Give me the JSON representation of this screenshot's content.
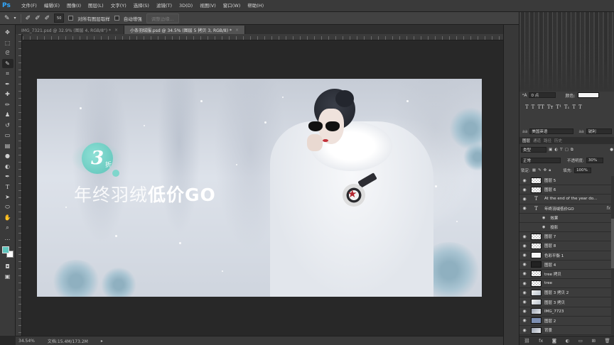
{
  "app": {
    "logo": "Ps"
  },
  "menu": [
    "文件(F)",
    "编辑(E)",
    "图像(I)",
    "图层(L)",
    "文字(Y)",
    "选择(S)",
    "滤镜(T)",
    "3D(D)",
    "视图(V)",
    "窗口(W)",
    "帮助(H)"
  ],
  "options": {
    "brush_size": "50",
    "sample_all_label": "对所有图层取样",
    "auto_enhance_label": "自动增强",
    "refine_edge_label": "调整边缘..."
  },
  "tabs": [
    {
      "label": "IMG_7321.psd @ 32.9% (图层 4, RGB/8\") *",
      "active": false
    },
    {
      "label": "小条羽绒服.psd @ 34.5% (图层 5 拷贝 3, RGB/8) *",
      "active": true
    }
  ],
  "canvas": {
    "badge_number": "3",
    "badge_suffix": "折",
    "headline_light": "年终羽绒",
    "headline_bold": "低价GO"
  },
  "status": {
    "zoom": "34.54%",
    "doc_info": "文档:15.4M/173.2M"
  },
  "character": {
    "tracking_value": "0 点",
    "color_label": "颜色:",
    "style_buttons": [
      "T",
      "T",
      "TT",
      "Tт",
      "T¹",
      "T₁",
      "T",
      "T"
    ],
    "language": "美国英语",
    "antialias": "锐利"
  },
  "layers_panel": {
    "tabs": [
      "图层",
      "通道",
      "路径",
      "历史"
    ],
    "kind_filter": "类型",
    "blend_mode": "正常",
    "opacity_label": "不透明度:",
    "opacity": "30%",
    "lock_label": "锁定:",
    "fill_label": "填充:",
    "fill": "100%",
    "layers": [
      {
        "name": "图层 5",
        "thumb": "checker",
        "selected": false,
        "fx": "",
        "indent": false
      },
      {
        "name": "图层 6",
        "thumb": "checker",
        "selected": false,
        "fx": "",
        "indent": false
      },
      {
        "name": "At the end of the year do...",
        "thumb": "text",
        "selected": false,
        "fx": "",
        "indent": false
      },
      {
        "name": "年终羽绒低价GO",
        "thumb": "text",
        "selected": false,
        "fx": "fx",
        "indent": false
      },
      {
        "name": "效果",
        "thumb": "none",
        "selected": false,
        "fx": "",
        "indent": true
      },
      {
        "name": "投影",
        "thumb": "none",
        "selected": false,
        "fx": "",
        "indent": true
      },
      {
        "name": "图层 7",
        "thumb": "checker",
        "selected": false,
        "fx": "",
        "indent": false
      },
      {
        "name": "图层 8",
        "thumb": "checker",
        "selected": false,
        "fx": "",
        "indent": false
      },
      {
        "name": "色彩平衡 1",
        "thumb": "white",
        "selected": false,
        "fx": "",
        "indent": false
      },
      {
        "name": "图层 4",
        "thumb": "dark",
        "selected": false,
        "fx": "",
        "indent": false
      },
      {
        "name": "tree 拷贝",
        "thumb": "checker",
        "selected": false,
        "fx": "",
        "indent": false
      },
      {
        "name": "tree",
        "thumb": "checker",
        "selected": false,
        "fx": "",
        "indent": false
      },
      {
        "name": "图层 3 拷贝 2",
        "thumb": "bright",
        "selected": false,
        "fx": "",
        "indent": false
      },
      {
        "name": "图层 3 拷贝",
        "thumb": "bright",
        "selected": false,
        "fx": "",
        "indent": false
      },
      {
        "name": "IMG_7723",
        "thumb": "photo",
        "selected": false,
        "fx": "",
        "indent": false
      },
      {
        "name": "图层 2",
        "thumb": "blue",
        "selected": false,
        "fx": "",
        "indent": false
      },
      {
        "name": "背景",
        "thumb": "photo",
        "selected": false,
        "fx": "",
        "indent": false
      }
    ]
  },
  "colors": {
    "accent_teal": "#5cc3b8",
    "ps_blue": "#31a8ff"
  }
}
